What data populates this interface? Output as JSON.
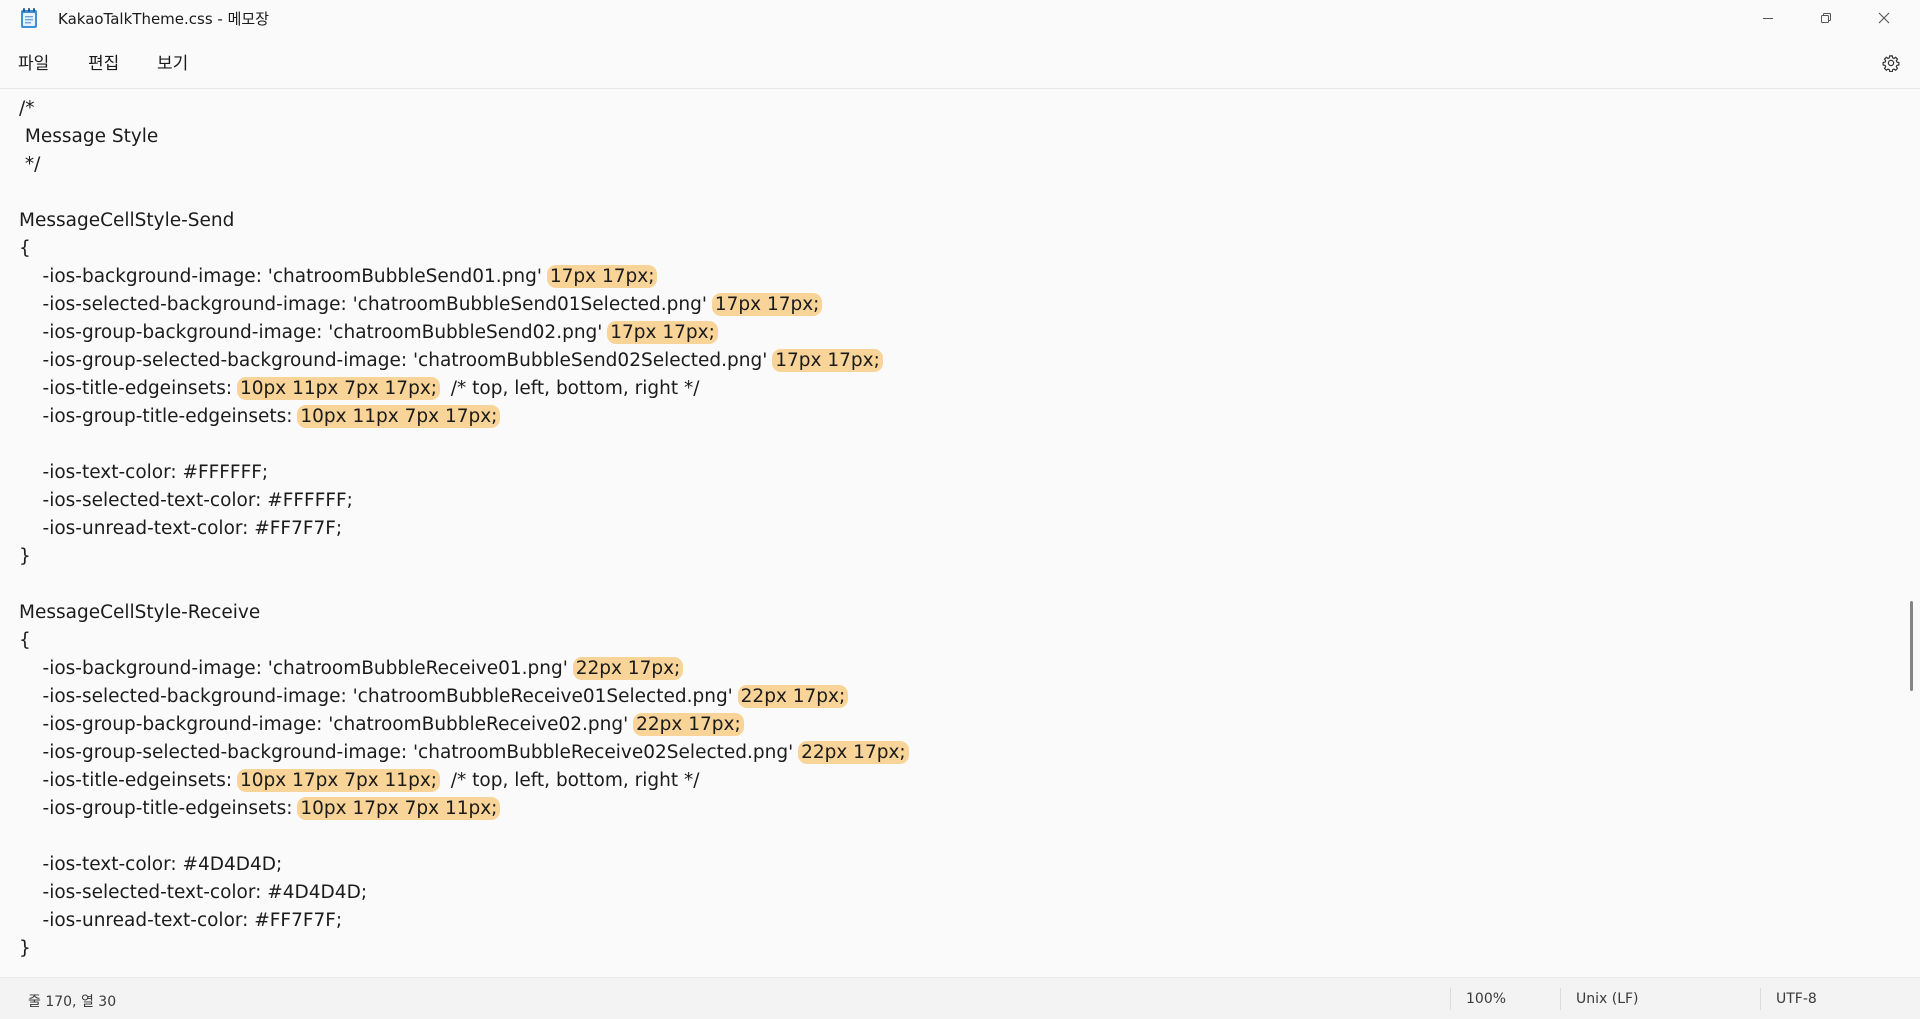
{
  "window": {
    "title": "KakaoTalkTheme.css - 메모장",
    "icon": "notepad-icon"
  },
  "window_controls": {
    "minimize_icon": "minimize-icon",
    "maximize_icon": "restore-icon",
    "close_icon": "close-icon"
  },
  "menu": {
    "file": "파일",
    "edit": "편집",
    "view": "보기",
    "settings_icon": "gear-icon"
  },
  "editor": {
    "highlight_color": "#f8d498",
    "lines": [
      [
        {
          "t": "/*"
        }
      ],
      [
        {
          "t": " Message Style"
        }
      ],
      [
        {
          "t": " */"
        }
      ],
      [
        {
          "t": ""
        }
      ],
      [
        {
          "t": "MessageCellStyle-Send"
        }
      ],
      [
        {
          "t": "{"
        }
      ],
      [
        {
          "t": "    -ios-background-image: 'chatroomBubbleSend01.png' "
        },
        {
          "t": "17px 17px;",
          "h": true
        }
      ],
      [
        {
          "t": "    -ios-selected-background-image: 'chatroomBubbleSend01Selected.png' "
        },
        {
          "t": "17px 17px;",
          "h": true
        }
      ],
      [
        {
          "t": "    -ios-group-background-image: 'chatroomBubbleSend02.png' "
        },
        {
          "t": "17px 17px;",
          "h": true
        }
      ],
      [
        {
          "t": "    -ios-group-selected-background-image: 'chatroomBubbleSend02Selected.png' "
        },
        {
          "t": "17px 17px;",
          "h": true
        }
      ],
      [
        {
          "t": "    -ios-title-edgeinsets: "
        },
        {
          "t": "10px 11px 7px 17px;",
          "h": true
        },
        {
          "t": "  /* top, left, bottom, right */"
        }
      ],
      [
        {
          "t": "    -ios-group-title-edgeinsets: "
        },
        {
          "t": "10px 11px 7px 17px;",
          "h": true
        }
      ],
      [
        {
          "t": ""
        }
      ],
      [
        {
          "t": "    -ios-text-color: #FFFFFF;"
        }
      ],
      [
        {
          "t": "    -ios-selected-text-color: #FFFFFF;"
        }
      ],
      [
        {
          "t": "    -ios-unread-text-color: #FF7F7F;"
        }
      ],
      [
        {
          "t": "}"
        }
      ],
      [
        {
          "t": ""
        }
      ],
      [
        {
          "t": "MessageCellStyle-Receive"
        }
      ],
      [
        {
          "t": "{"
        }
      ],
      [
        {
          "t": "    -ios-background-image: 'chatroomBubbleReceive01.png' "
        },
        {
          "t": "22px 17px;",
          "h": true
        }
      ],
      [
        {
          "t": "    -ios-selected-background-image: 'chatroomBubbleReceive01Selected.png' "
        },
        {
          "t": "22px 17px;",
          "h": true
        }
      ],
      [
        {
          "t": "    -ios-group-background-image: 'chatroomBubbleReceive02.png' "
        },
        {
          "t": "22px 17px;",
          "h": true
        }
      ],
      [
        {
          "t": "    -ios-group-selected-background-image: 'chatroomBubbleReceive02Selected.png' "
        },
        {
          "t": "22px 17px;",
          "h": true
        }
      ],
      [
        {
          "t": "    -ios-title-edgeinsets: "
        },
        {
          "t": "10px 17px 7px 11px;",
          "h": true
        },
        {
          "t": "  /* top, left, bottom, right */"
        }
      ],
      [
        {
          "t": "    -ios-group-title-edgeinsets: "
        },
        {
          "t": "10px 17px 7px 11px;",
          "h": true
        }
      ],
      [
        {
          "t": ""
        }
      ],
      [
        {
          "t": "    -ios-text-color: #4D4D4D;"
        }
      ],
      [
        {
          "t": "    -ios-selected-text-color: #4D4D4D;"
        }
      ],
      [
        {
          "t": "    -ios-unread-text-color: #FF7F7F;"
        }
      ],
      [
        {
          "t": "}"
        }
      ]
    ]
  },
  "status": {
    "position": "줄 170, 열 30",
    "zoom": "100%",
    "line_ending": "Unix (LF)",
    "encoding": "UTF-8"
  }
}
